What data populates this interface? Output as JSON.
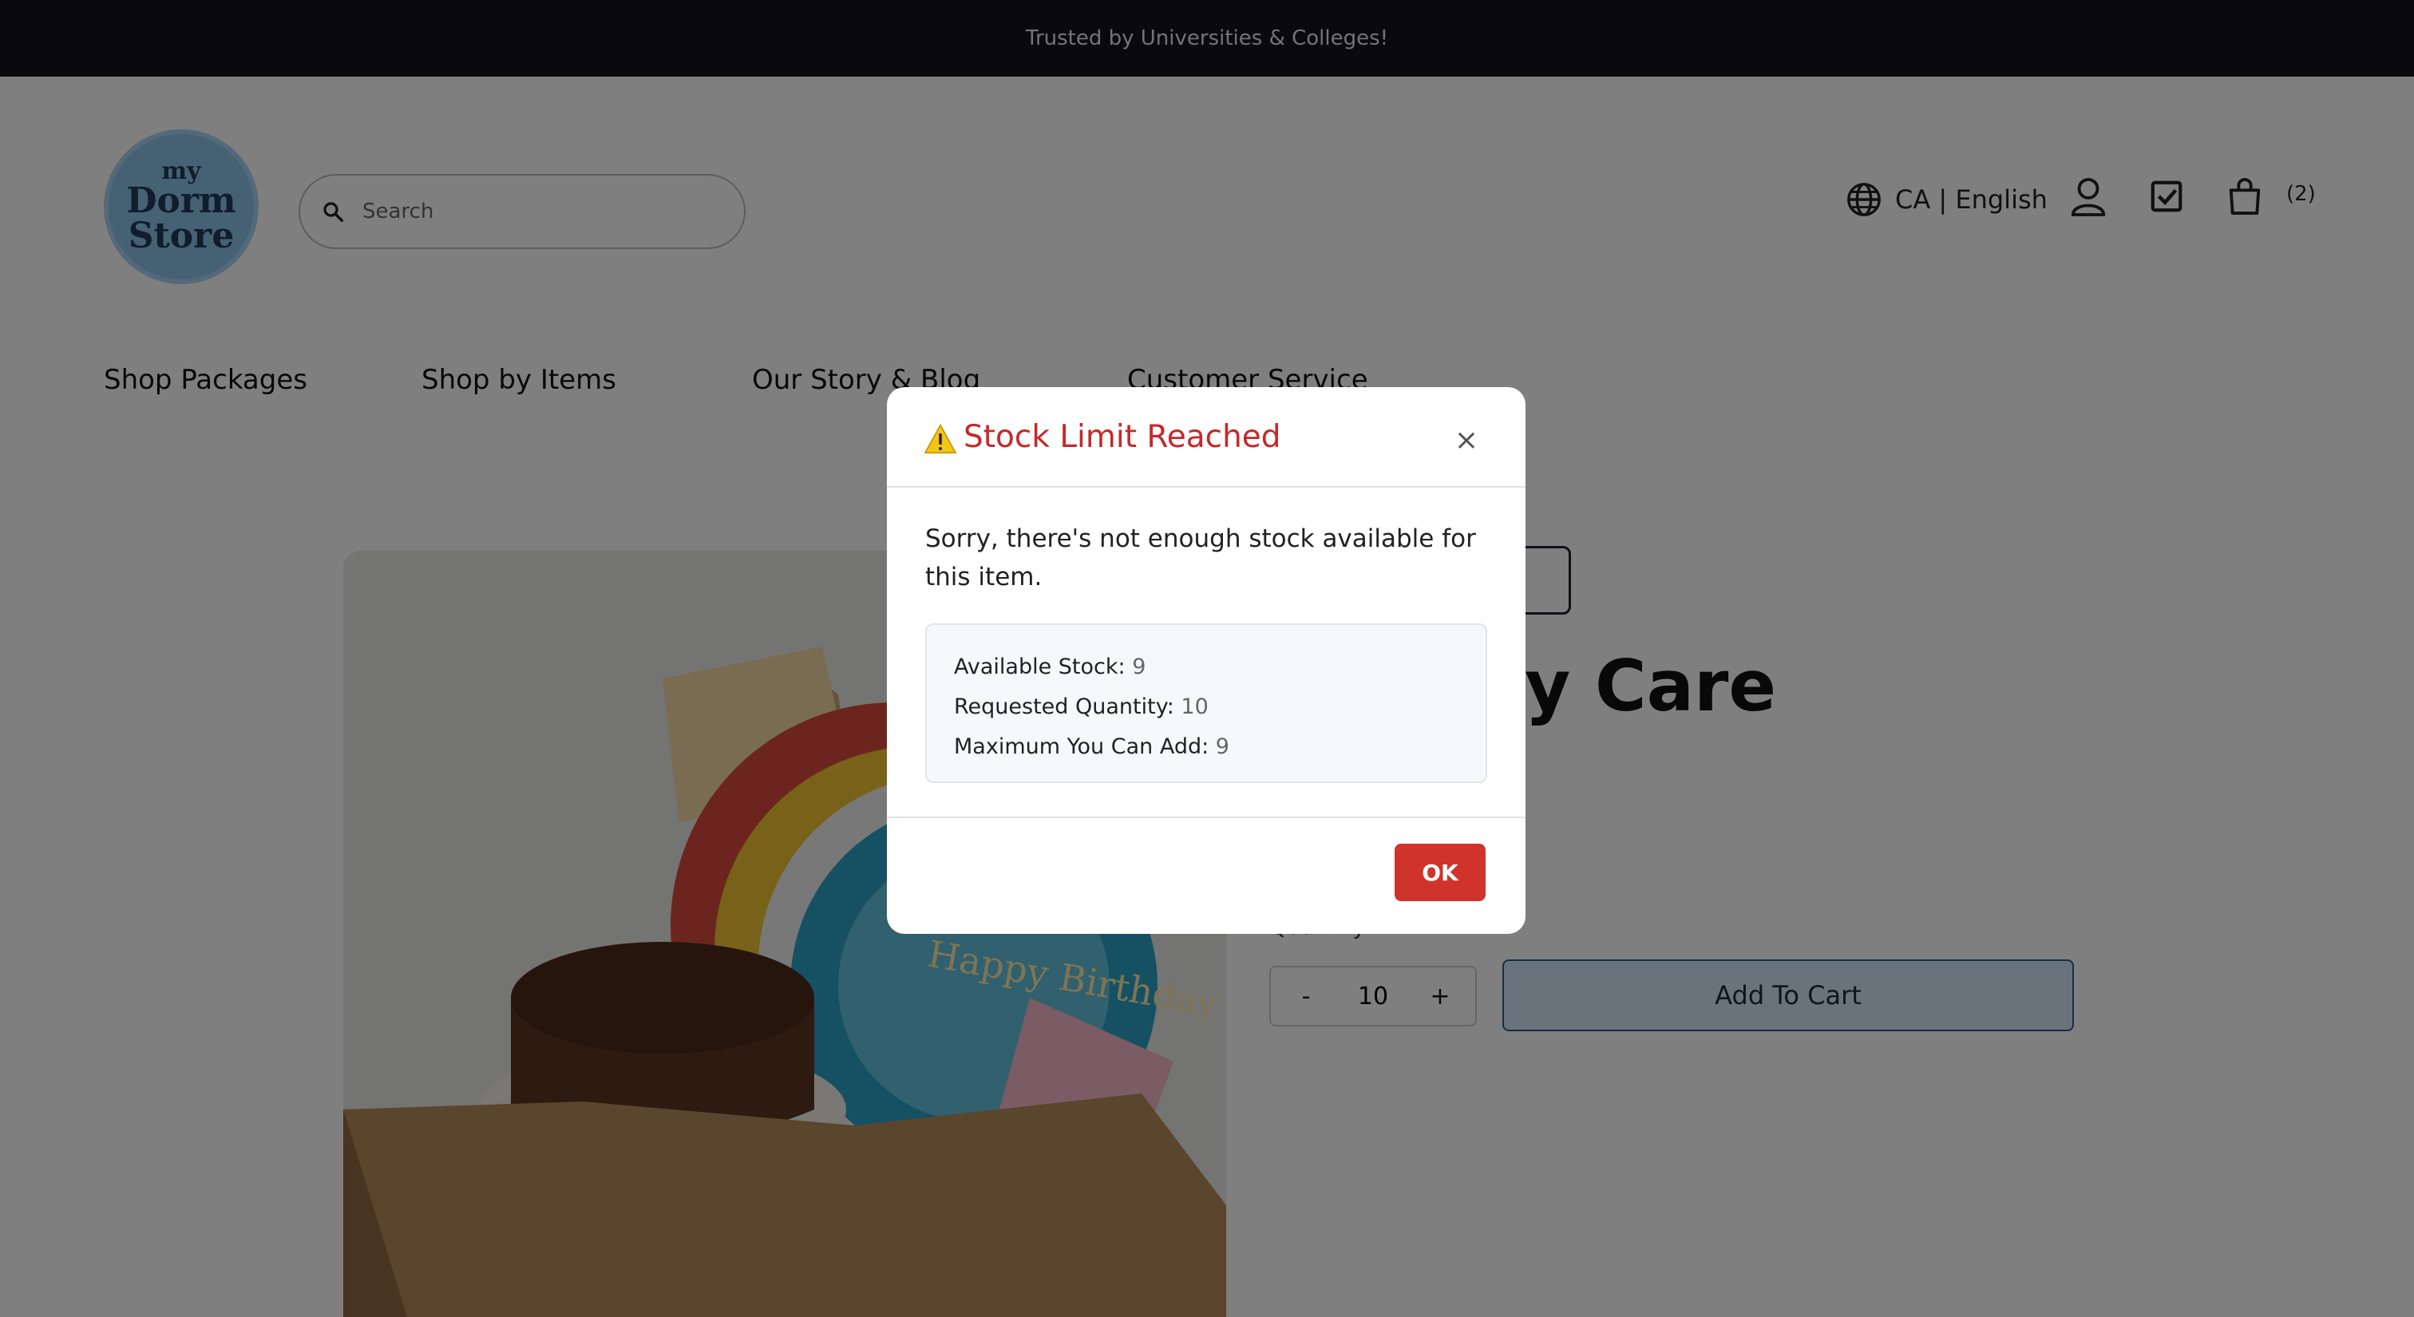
{
  "announcement": "Trusted by Universities & Colleges!",
  "logo": {
    "line1": "my",
    "line2": "Dorm",
    "line3": "Store"
  },
  "search": {
    "placeholder": "Search"
  },
  "header": {
    "locale": "CA | English",
    "cart_count": "(2)"
  },
  "nav": {
    "items": [
      "Shop Packages",
      "Shop by Items",
      "Our Story & Blog",
      "Customer Service"
    ]
  },
  "product": {
    "title_visible": "y Care",
    "quantity_label": "Quantity",
    "quantity": "10",
    "minus": "-",
    "plus": "+",
    "add_to_cart": "Add To Cart",
    "image_text": "Happy Birthday"
  },
  "modal": {
    "icon": "warning-icon",
    "title": "Stock Limit Reached",
    "close": "×",
    "message": "Sorry, there's not enough stock available for this item.",
    "rows": [
      {
        "label": "Available Stock:",
        "value": "9"
      },
      {
        "label": "Requested Quantity:",
        "value": "10"
      },
      {
        "label": "Maximum You Can Add:",
        "value": "9"
      }
    ],
    "ok": "OK"
  },
  "colors": {
    "accent_red": "#d0332c",
    "title_red": "#c62828",
    "announcement_bg": "#14141c",
    "add_to_cart_bg": "#d4e6f7"
  }
}
